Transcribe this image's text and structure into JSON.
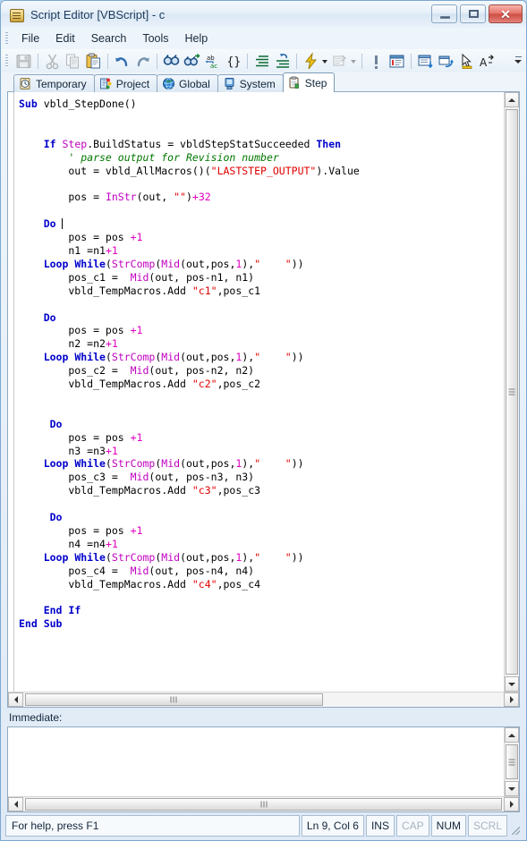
{
  "window": {
    "title": "Script Editor [VBScript] - c",
    "icon": "scroll-icon",
    "controls": {
      "minimize": "minimize-button",
      "maximize": "maximize-button",
      "close": "close-button"
    }
  },
  "menu": {
    "items": [
      {
        "label": "File"
      },
      {
        "label": "Edit"
      },
      {
        "label": "Search"
      },
      {
        "label": "Tools"
      },
      {
        "label": "Help"
      }
    ]
  },
  "toolbar": {
    "items": [
      {
        "name": "save-icon",
        "enabled": false
      },
      {
        "name": "separator"
      },
      {
        "name": "cut-icon",
        "enabled": false
      },
      {
        "name": "copy-icon",
        "enabled": false
      },
      {
        "name": "paste-icon",
        "enabled": true
      },
      {
        "name": "separator"
      },
      {
        "name": "undo-icon",
        "enabled": true
      },
      {
        "name": "redo-icon",
        "enabled": true
      },
      {
        "name": "separator"
      },
      {
        "name": "find-icon",
        "enabled": true
      },
      {
        "name": "find-next-icon",
        "enabled": true
      },
      {
        "name": "replace-icon",
        "enabled": true
      },
      {
        "name": "braces-icon",
        "enabled": true
      },
      {
        "name": "separator"
      },
      {
        "name": "indent-icon",
        "enabled": true
      },
      {
        "name": "outdent-icon",
        "enabled": true
      },
      {
        "name": "separator"
      },
      {
        "name": "run-icon",
        "enabled": true
      },
      {
        "name": "run-dropdown-arrow",
        "enabled": true
      },
      {
        "name": "properties-icon",
        "enabled": false
      },
      {
        "name": "properties-dropdown-arrow",
        "enabled": false
      },
      {
        "name": "separator"
      },
      {
        "name": "breakpoint-icon",
        "enabled": true
      },
      {
        "name": "watch-window-icon",
        "enabled": true
      },
      {
        "name": "separator"
      },
      {
        "name": "step-into-icon",
        "enabled": true
      },
      {
        "name": "step-over-icon",
        "enabled": true
      },
      {
        "name": "cursor-icon",
        "enabled": true
      },
      {
        "name": "font-size-icon",
        "enabled": true
      },
      {
        "name": "toolbar-overflow-icon",
        "enabled": true
      }
    ]
  },
  "tabs": {
    "items": [
      {
        "label": "Temporary",
        "icon": "clock-icon",
        "active": false
      },
      {
        "label": "Project",
        "icon": "project-tree-icon",
        "active": false
      },
      {
        "label": "Global",
        "icon": "globe-icon",
        "active": false
      },
      {
        "label": "System",
        "icon": "computer-icon",
        "active": false
      },
      {
        "label": "Step",
        "icon": "clipboard-icon",
        "active": true
      }
    ]
  },
  "editor": {
    "language": "VBScript",
    "caret_line_index": 8,
    "lines": [
      [
        {
          "t": "Sub ",
          "c": "k"
        },
        {
          "t": "vbld_StepDone()",
          "c": "id"
        }
      ],
      [],
      [],
      [
        {
          "t": "    ",
          "c": "id"
        },
        {
          "t": "If ",
          "c": "k"
        },
        {
          "t": "Step",
          "c": "fn"
        },
        {
          "t": ".BuildStatus = vbldStepStatSucceeded ",
          "c": "id"
        },
        {
          "t": "Then",
          "c": "k"
        }
      ],
      [
        {
          "t": "        ",
          "c": "id"
        },
        {
          "t": "' parse output for Revision number",
          "c": "cmt"
        }
      ],
      [
        {
          "t": "        out = vbld_AllMacros()(",
          "c": "id"
        },
        {
          "t": "\"LASTSTEP_OUTPUT\"",
          "c": "str"
        },
        {
          "t": ").Value",
          "c": "id"
        }
      ],
      [],
      [
        {
          "t": "        pos = ",
          "c": "id"
        },
        {
          "t": "InStr",
          "c": "fn"
        },
        {
          "t": "(out, ",
          "c": "id"
        },
        {
          "t": "\"\"",
          "c": "str"
        },
        {
          "t": ")",
          "c": "id"
        },
        {
          "t": "+32",
          "c": "num"
        }
      ],
      [],
      [
        {
          "t": "    ",
          "c": "id"
        },
        {
          "t": "Do ",
          "c": "k"
        },
        {
          "t": "CARET",
          "c": "caret"
        }
      ],
      [
        {
          "t": "        pos = pos ",
          "c": "id"
        },
        {
          "t": "+1",
          "c": "num"
        }
      ],
      [
        {
          "t": "        n1 =n1",
          "c": "id"
        },
        {
          "t": "+1",
          "c": "num"
        }
      ],
      [
        {
          "t": "    ",
          "c": "id"
        },
        {
          "t": "Loop While",
          "c": "k"
        },
        {
          "t": "(",
          "c": "id"
        },
        {
          "t": "StrComp",
          "c": "fn"
        },
        {
          "t": "(",
          "c": "id"
        },
        {
          "t": "Mid",
          "c": "fn"
        },
        {
          "t": "(out,pos,",
          "c": "id"
        },
        {
          "t": "1",
          "c": "num"
        },
        {
          "t": "),",
          "c": "id"
        },
        {
          "t": "\"    \"",
          "c": "str"
        },
        {
          "t": "))",
          "c": "id"
        }
      ],
      [
        {
          "t": "        pos_c1 =  ",
          "c": "id"
        },
        {
          "t": "Mid",
          "c": "fn"
        },
        {
          "t": "(out, pos-n1, n1)",
          "c": "id"
        }
      ],
      [
        {
          "t": "        vbld_TempMacros.Add ",
          "c": "id"
        },
        {
          "t": "\"c1\"",
          "c": "str"
        },
        {
          "t": ",pos_c1",
          "c": "id"
        }
      ],
      [],
      [
        {
          "t": "    ",
          "c": "id"
        },
        {
          "t": "Do",
          "c": "k"
        }
      ],
      [
        {
          "t": "        pos = pos ",
          "c": "id"
        },
        {
          "t": "+1",
          "c": "num"
        }
      ],
      [
        {
          "t": "        n2 =n2",
          "c": "id"
        },
        {
          "t": "+1",
          "c": "num"
        }
      ],
      [
        {
          "t": "    ",
          "c": "id"
        },
        {
          "t": "Loop While",
          "c": "k"
        },
        {
          "t": "(",
          "c": "id"
        },
        {
          "t": "StrComp",
          "c": "fn"
        },
        {
          "t": "(",
          "c": "id"
        },
        {
          "t": "Mid",
          "c": "fn"
        },
        {
          "t": "(out,pos,",
          "c": "id"
        },
        {
          "t": "1",
          "c": "num"
        },
        {
          "t": "),",
          "c": "id"
        },
        {
          "t": "\"    \"",
          "c": "str"
        },
        {
          "t": "))",
          "c": "id"
        }
      ],
      [
        {
          "t": "        pos_c2 =  ",
          "c": "id"
        },
        {
          "t": "Mid",
          "c": "fn"
        },
        {
          "t": "(out, pos-n2, n2)",
          "c": "id"
        }
      ],
      [
        {
          "t": "        vbld_TempMacros.Add ",
          "c": "id"
        },
        {
          "t": "\"c2\"",
          "c": "str"
        },
        {
          "t": ",pos_c2",
          "c": "id"
        }
      ],
      [],
      [],
      [
        {
          "t": "     ",
          "c": "id"
        },
        {
          "t": "Do",
          "c": "k"
        }
      ],
      [
        {
          "t": "        pos = pos ",
          "c": "id"
        },
        {
          "t": "+1",
          "c": "num"
        }
      ],
      [
        {
          "t": "        n3 =n3",
          "c": "id"
        },
        {
          "t": "+1",
          "c": "num"
        }
      ],
      [
        {
          "t": "    ",
          "c": "id"
        },
        {
          "t": "Loop While",
          "c": "k"
        },
        {
          "t": "(",
          "c": "id"
        },
        {
          "t": "StrComp",
          "c": "fn"
        },
        {
          "t": "(",
          "c": "id"
        },
        {
          "t": "Mid",
          "c": "fn"
        },
        {
          "t": "(out,pos,",
          "c": "id"
        },
        {
          "t": "1",
          "c": "num"
        },
        {
          "t": "),",
          "c": "id"
        },
        {
          "t": "\"    \"",
          "c": "str"
        },
        {
          "t": "))",
          "c": "id"
        }
      ],
      [
        {
          "t": "        pos_c3 =  ",
          "c": "id"
        },
        {
          "t": "Mid",
          "c": "fn"
        },
        {
          "t": "(out, pos-n3, n3)",
          "c": "id"
        }
      ],
      [
        {
          "t": "        vbld_TempMacros.Add ",
          "c": "id"
        },
        {
          "t": "\"c3\"",
          "c": "str"
        },
        {
          "t": ",pos_c3",
          "c": "id"
        }
      ],
      [],
      [
        {
          "t": "     ",
          "c": "id"
        },
        {
          "t": "Do",
          "c": "k"
        }
      ],
      [
        {
          "t": "        pos = pos ",
          "c": "id"
        },
        {
          "t": "+1",
          "c": "num"
        }
      ],
      [
        {
          "t": "        n4 =n4",
          "c": "id"
        },
        {
          "t": "+1",
          "c": "num"
        }
      ],
      [
        {
          "t": "    ",
          "c": "id"
        },
        {
          "t": "Loop While",
          "c": "k"
        },
        {
          "t": "(",
          "c": "id"
        },
        {
          "t": "StrComp",
          "c": "fn"
        },
        {
          "t": "(",
          "c": "id"
        },
        {
          "t": "Mid",
          "c": "fn"
        },
        {
          "t": "(out,pos,",
          "c": "id"
        },
        {
          "t": "1",
          "c": "num"
        },
        {
          "t": "),",
          "c": "id"
        },
        {
          "t": "\"    \"",
          "c": "str"
        },
        {
          "t": "))",
          "c": "id"
        }
      ],
      [
        {
          "t": "        pos_c4 =  ",
          "c": "id"
        },
        {
          "t": "Mid",
          "c": "fn"
        },
        {
          "t": "(out, pos-n4, n4)",
          "c": "id"
        }
      ],
      [
        {
          "t": "        vbld_TempMacros.Add ",
          "c": "id"
        },
        {
          "t": "\"c4\"",
          "c": "str"
        },
        {
          "t": ",pos_c4",
          "c": "id"
        }
      ],
      [],
      [
        {
          "t": "    ",
          "c": "id"
        },
        {
          "t": "End If",
          "c": "k"
        }
      ],
      [
        {
          "t": "",
          "c": "id"
        },
        {
          "t": "End Sub",
          "c": "k"
        }
      ]
    ],
    "colors": {
      "keyword": "#0000CC",
      "function": "#C000C0",
      "string": "#E00000",
      "number": "#E000C0",
      "comment": "#007800",
      "text": "#000000",
      "background": "#FFFFFF"
    }
  },
  "immediate": {
    "label": "Immediate:",
    "value": ""
  },
  "statusbar": {
    "help_text": "For help, press F1",
    "cells": [
      {
        "label": "Ln 9, Col 6",
        "dim": false,
        "name": "caret-position"
      },
      {
        "label": "INS",
        "dim": false,
        "name": "insert-mode"
      },
      {
        "label": "CAP",
        "dim": true,
        "name": "caps-lock"
      },
      {
        "label": "NUM",
        "dim": false,
        "name": "num-lock"
      },
      {
        "label": "SCRL",
        "dim": true,
        "name": "scroll-lock"
      }
    ]
  }
}
